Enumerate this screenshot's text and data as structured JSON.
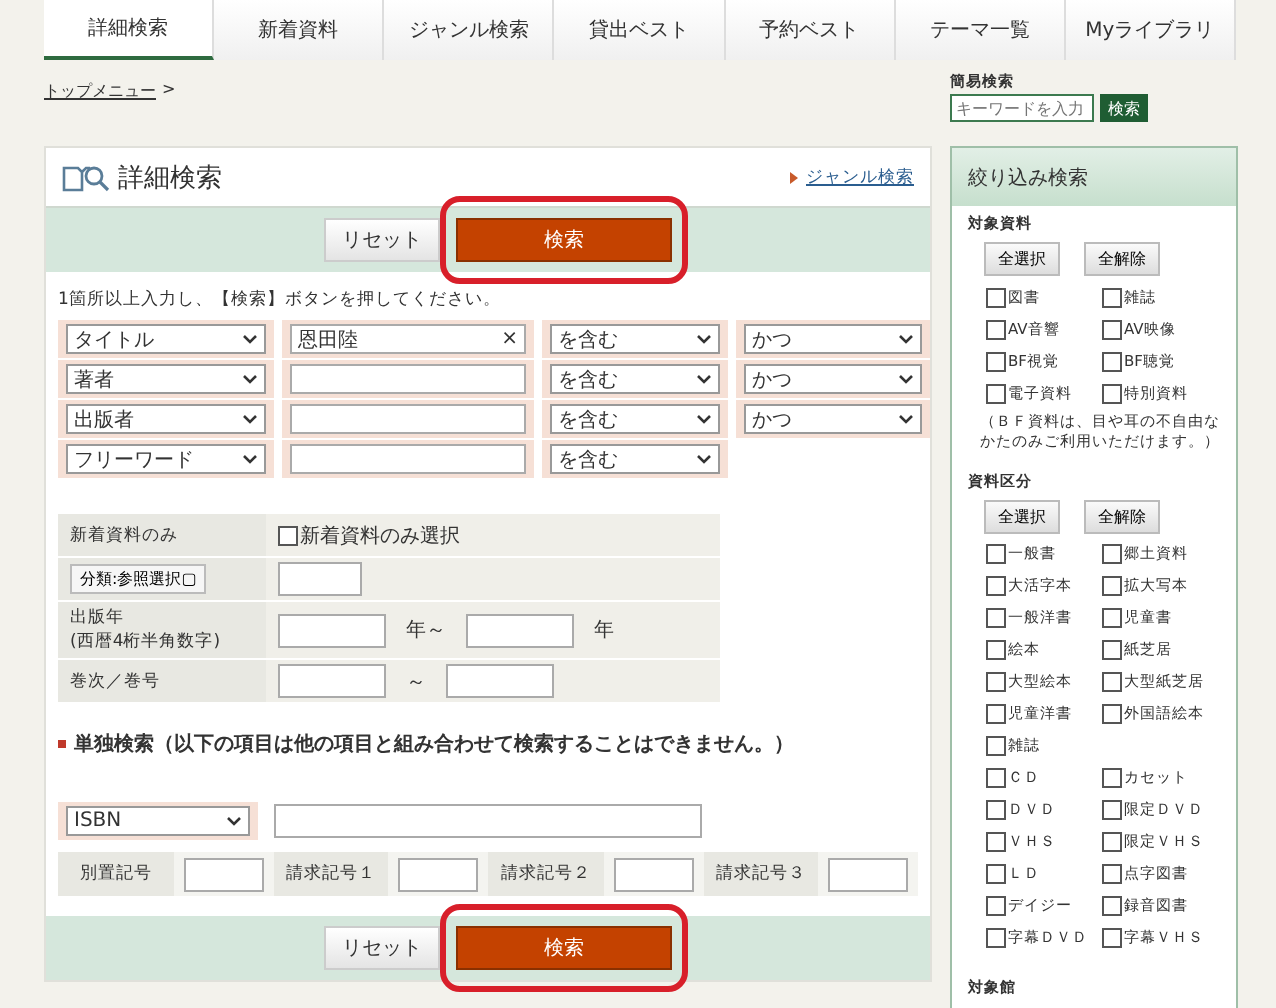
{
  "tabs": [
    {
      "label": "詳細検索",
      "selected": true
    },
    {
      "label": "新着資料",
      "selected": false
    },
    {
      "label": "ジャンル検索",
      "selected": false
    },
    {
      "label": "貸出ベスト",
      "selected": false
    },
    {
      "label": "予約ベスト",
      "selected": false
    },
    {
      "label": "テーマ一覧",
      "selected": false
    },
    {
      "label": "Myライブラリ",
      "selected": false
    }
  ],
  "breadcrumb": {
    "link": "トップメニュー",
    "separator": ">"
  },
  "quick_search": {
    "label": "簡易検索",
    "placeholder": "キーワードを入力",
    "button": "検索"
  },
  "main": {
    "title": "詳細検索",
    "genre_link": "ジャンル検索",
    "button_bars": [
      {
        "reset": "リセット",
        "search": "検索",
        "highlighted": true
      },
      {
        "reset": "リセット",
        "search": "検索",
        "highlighted": true
      }
    ],
    "instruction": "1箇所以上入力し、【検索】ボタンを押してください。",
    "criteria": [
      {
        "field": "タイトル",
        "value": "恩田陸",
        "clear_icon": "×",
        "match": "を含む",
        "conjunction": "かつ"
      },
      {
        "field": "著者",
        "match": "を含む",
        "conjunction": "かつ"
      },
      {
        "field": "出版者",
        "match": "を含む",
        "conjunction": "かつ"
      },
      {
        "field": "フリーワード",
        "match": "を含む"
      }
    ],
    "new_only": {
      "label": "新着資料のみ",
      "checkbox": "新着資料のみ選択",
      "checked": false
    },
    "classification_button": "分類:参照選択▢",
    "year": {
      "label": "出版年",
      "note": "(西暦4桁半角数字)",
      "from_suffix": "年～",
      "to_suffix": "年"
    },
    "volume": {
      "label": "巻次／巻号",
      "separator": "～"
    },
    "single_heading": "単独検索（以下の項目は他の項目と組み合わせて検索することはできません。）",
    "single_field": "ISBN",
    "codes": [
      "別置記号",
      "請求記号１",
      "請求記号２",
      "請求記号３"
    ]
  },
  "sidebar": {
    "title": "絞り込み検索",
    "groups": [
      {
        "heading": "対象資料",
        "select_all": "全選択",
        "clear_all": "全解除",
        "note": "（ＢＦ資料は、目や耳の不自由なかたのみご利用いただけます。）",
        "items": [
          {
            "label": "図書",
            "checked": false
          },
          {
            "label": "雑誌",
            "checked": false
          },
          {
            "label": "AV音響",
            "checked": false
          },
          {
            "label": "AV映像",
            "checked": false
          },
          {
            "label": "BF視覚",
            "checked": false
          },
          {
            "label": "BF聴覚",
            "checked": false
          },
          {
            "label": "電子資料",
            "checked": false
          },
          {
            "label": "特別資料",
            "checked": false
          }
        ]
      },
      {
        "heading": "資料区分",
        "select_all": "全選択",
        "clear_all": "全解除",
        "items": [
          {
            "label": "一般書",
            "checked": false
          },
          {
            "label": "郷土資料",
            "checked": false
          },
          {
            "label": "大活字本",
            "checked": false
          },
          {
            "label": "拡大写本",
            "checked": false
          },
          {
            "label": "一般洋書",
            "checked": false
          },
          {
            "label": "児童書",
            "checked": false
          },
          {
            "label": "絵本",
            "checked": false
          },
          {
            "label": "紙芝居",
            "checked": false
          },
          {
            "label": "大型絵本",
            "checked": false
          },
          {
            "label": "大型紙芝居",
            "checked": false
          },
          {
            "label": "児童洋書",
            "checked": false
          },
          {
            "label": "外国語絵本",
            "checked": false
          },
          {
            "label": "雑誌",
            "checked": false,
            "row_end": true
          },
          {
            "label": "ＣＤ",
            "checked": false
          },
          {
            "label": "カセット",
            "checked": false
          },
          {
            "label": "ＤＶＤ",
            "checked": false
          },
          {
            "label": "限定ＤＶＤ",
            "checked": false
          },
          {
            "label": "ＶＨＳ",
            "checked": false
          },
          {
            "label": "限定ＶＨＳ",
            "checked": false
          },
          {
            "label": "ＬＤ",
            "checked": false
          },
          {
            "label": "点字図書",
            "checked": false
          },
          {
            "label": "デイジー",
            "checked": false
          },
          {
            "label": "録音図書",
            "checked": false
          },
          {
            "label": "字幕ＤＶＤ",
            "checked": false
          },
          {
            "label": "字幕ＶＨＳ",
            "checked": false
          }
        ]
      }
    ],
    "next_heading": "対象館"
  }
}
